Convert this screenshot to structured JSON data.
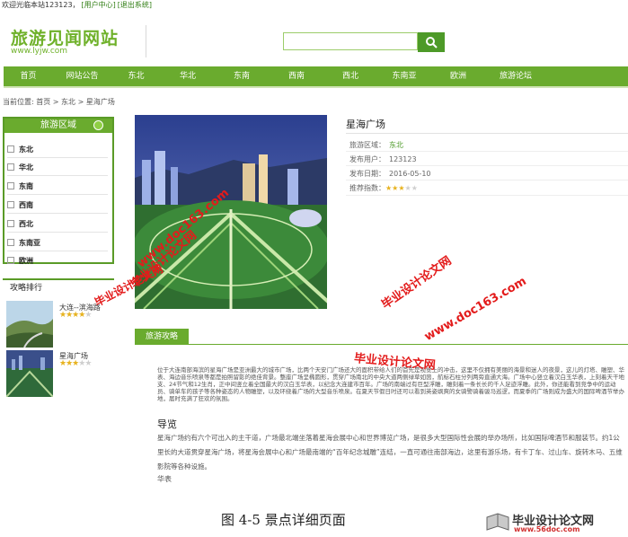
{
  "topbar": {
    "welcome": "欢迎光临本站123123，",
    "user_center": "[用户中心]",
    "logout": "[退出系统]"
  },
  "header": {
    "logo_title": "旅游见闻网站",
    "logo_url": "www.lyjw.com",
    "search_placeholder": ""
  },
  "nav": {
    "items": [
      "首页",
      "网站公告",
      "东北",
      "华北",
      "东南",
      "西南",
      "西北",
      "东南亚",
      "欧洲",
      "旅游论坛"
    ]
  },
  "breadcrumb": "当前位置: 首页 > 东北 > 星海广场",
  "sidebar": {
    "region_title": "旅游区域",
    "regions": [
      "东北",
      "华北",
      "东南",
      "西南",
      "西北",
      "东南亚",
      "欧洲"
    ],
    "rank_title": "攻略排行",
    "rank_items": [
      {
        "name": "大连--滨海路",
        "stars": 4
      },
      {
        "name": "星海广场",
        "stars": 3
      }
    ]
  },
  "detail": {
    "title": "星海广场",
    "region_label": "旅游区域：",
    "region_value": "东北",
    "publisher_label": "发布用户：",
    "publisher_value": "123123",
    "date_label": "发布日期：",
    "date_value": "2016-05-10",
    "rating_label": "推荐指数：",
    "rating": 3
  },
  "tabs": {
    "active": "旅游攻略"
  },
  "content": {
    "intro": "位于大连南部海滨的星海广场是亚洲最大的城市广场，比两个天安门广场还大的面积带给人们的首先是视觉上的冲击，这里不仅拥有美丽的海景和迷人的夜景，这儿的灯塔、雕塑、华表、海边音乐喷泉等都是拍照留影的绝佳背景。整座广场呈椭圆形，贯穿广场南北的中央大道两侧绿草如茵，航标石柱分列两旁直通大海。广场中心竖立着汉白玉华表，上刻着天干地支、24节气和12生肖，正中间竖立着全国最大的汉白玉华表，以纪念大连建市百年。广场的南端过有巨型浮雕，雕刻着一条长长的千人足迹浮雕。此外，你还能看到竞争中的运动员、骑单车的孩子等各种姿态的人物雕塑，以及环绕着广场的大型音乐喷泉。在夏天节假日时还可以看到英姿飒爽的女骑警骑着骏马巡逻，而夏季的广场则成为盛大的国际啤酒节举办地，届时充满了狂欢的氛围。",
    "section_title": "导览",
    "section_text": "星海广场约有六个可出入的主干道，广场最北端坐落着星海会展中心和世界博览广场，是很多大型国际性会展的举办场所，比如国际啤酒节和服装节。约1公里长的大道贯穿星海广场，将星海会展中心和广场最南端的“百年纪念城雕”连结，一直可通往南部海边，这里有游乐场，有卡丁车、过山车、旋转木马、五维影院等各种设施。",
    "sign": "华表"
  },
  "caption": "图 4-5 景点详细页面",
  "footer": {
    "logo_text": "毕业设计论文网",
    "url": "www.56doc.com"
  },
  "watermarks": {
    "url": "www.doc163.com",
    "brand": "毕业设计论文网"
  },
  "colors": {
    "nav_green": "#6aab2e",
    "logo_green": "#6fb12a",
    "accent_green": "#4d9a28",
    "star_gold": "#e7b21e",
    "watermark_red": "#e31b1b"
  }
}
